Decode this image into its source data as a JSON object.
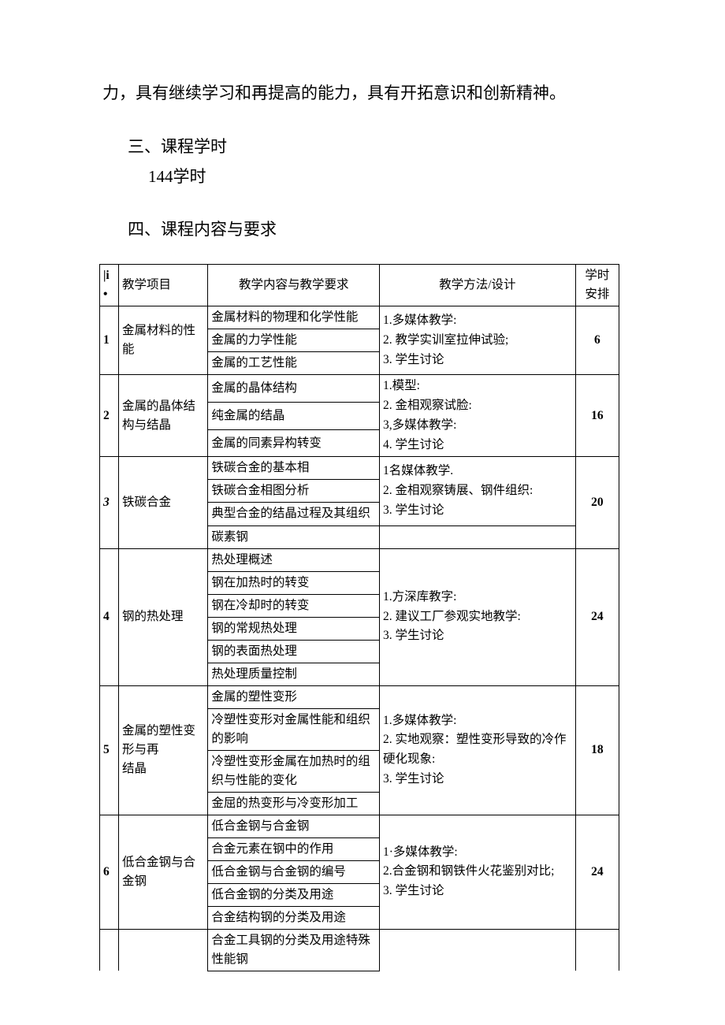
{
  "paragraph1": "力，具有继续学习和再提高的能力，具有开拓意识和创新精神。",
  "heading3": "三、课程学时",
  "hours_text": "144学时",
  "heading4": "四、课程内容与要求",
  "table": {
    "headers": {
      "idx": "|i\n•",
      "item": "教学项目",
      "content": "教学内容与教学要求",
      "method": "教学方法/设计",
      "hours": "学时安排"
    },
    "chart_data": {
      "type": "table",
      "rows": [
        {
          "idx": "1",
          "item": "金属材料的性能",
          "contents": [
            "金属材料的物理和化学性能",
            "金属的力学性能",
            "金属的工艺性能"
          ],
          "method": "1.多媒体教学:\n2. 教学实训室拉伸试验;\n3. 学生讨论",
          "hours": "6"
        },
        {
          "idx": "2",
          "item": "金属的晶体结构与结晶",
          "contents": [
            "金属的晶体结构",
            "纯金属的结晶",
            "金属的同素异构转变"
          ],
          "method": "1.模型:\n2. 金相观察试脸:\n3,多媒体教学:\n4. 学生讨论",
          "hours": "16"
        },
        {
          "idx": "3",
          "item": "铁碳合金",
          "contents": [
            "铁碳合金的基本相",
            "铁碳合金相图分析",
            "典型合金的结晶过程及其组织",
            "碳素钢"
          ],
          "method": "1名媒体教学.\n2. 金相观察铸展、钢件组织:\n3. 学生讨论",
          "hours": "20"
        },
        {
          "idx": "4",
          "item": "钢的热处理",
          "contents": [
            "热处理概述",
            "钢在加热时的转变",
            "钢在冷却时的转变",
            "钢的常规热处理",
            "钢的表面热处理",
            "热处理质量控制"
          ],
          "method": "1.方深库教字:\n2. 建议工厂参观实地教学:\n3. 学生讨论",
          "hours": "24"
        },
        {
          "idx": "5",
          "item": "金属的塑性变形与再\n结晶",
          "contents": [
            "金属的塑性变形",
            "冷塑性变形对金属性能和组织的影响",
            "冷塑性变形金属在加热时的组织与性能的变化",
            "金屈的热变形与冷变形加工"
          ],
          "method": "1.多媒体教学:\n2. 实地观察：塑性变形导致的冷作硬化现象:\n3. 学生讨论",
          "hours": "18"
        },
        {
          "idx": "6",
          "item": "低合金钢与合金钢",
          "contents": [
            "低合金钢与合金钢",
            "合金元素在钢中的作用",
            "低合金钢与合金钢的编号",
            "低合金钢的分类及用途",
            "合金结构钢的分类及用途"
          ],
          "method": "1·多媒体教学:\n2.合金钢和钢铁件火花鉴别对比;\n3. 学生讨论",
          "hours": "24"
        },
        {
          "idx": "",
          "item": "",
          "contents": [
            "合金工具钢的分类及用途特殊性能钢"
          ],
          "method": "",
          "hours": ""
        }
      ]
    }
  }
}
